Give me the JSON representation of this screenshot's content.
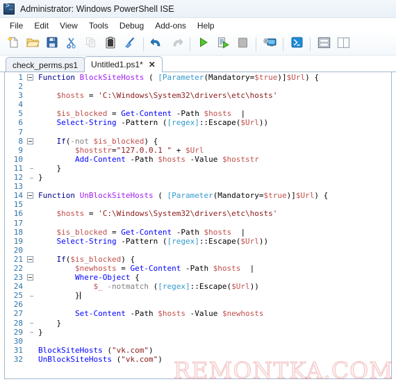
{
  "window": {
    "title": "Administrator: Windows PowerShell ISE",
    "icon": "powershell-ise-icon"
  },
  "menubar": {
    "items": [
      {
        "label": "File"
      },
      {
        "label": "Edit"
      },
      {
        "label": "View"
      },
      {
        "label": "Tools"
      },
      {
        "label": "Debug"
      },
      {
        "label": "Add-ons"
      },
      {
        "label": "Help"
      }
    ]
  },
  "toolbar": {
    "buttons": [
      {
        "name": "new-script-icon",
        "glyph": "new"
      },
      {
        "name": "open-script-icon",
        "glyph": "open"
      },
      {
        "name": "save-icon",
        "glyph": "save"
      },
      {
        "name": "cut-icon",
        "glyph": "cut"
      },
      {
        "name": "copy-icon",
        "glyph": "copy"
      },
      {
        "name": "paste-icon",
        "glyph": "paste"
      },
      {
        "name": "clear-console-icon",
        "glyph": "clear"
      },
      {
        "name": "separator-1",
        "glyph": "sep"
      },
      {
        "name": "undo-icon",
        "glyph": "undo"
      },
      {
        "name": "redo-icon",
        "glyph": "redo"
      },
      {
        "name": "separator-2",
        "glyph": "sep"
      },
      {
        "name": "run-script-icon",
        "glyph": "run"
      },
      {
        "name": "run-selection-icon",
        "glyph": "run-selection"
      },
      {
        "name": "stop-operation-icon",
        "glyph": "stop"
      },
      {
        "name": "separator-3",
        "glyph": "sep"
      },
      {
        "name": "new-remote-tab-icon",
        "glyph": "remote"
      },
      {
        "name": "separator-4",
        "glyph": "sep"
      },
      {
        "name": "start-powershell-icon",
        "glyph": "ps"
      },
      {
        "name": "separator-5",
        "glyph": "sep"
      },
      {
        "name": "show-script-pane-top-icon",
        "glyph": "pane-top"
      },
      {
        "name": "show-script-pane-right-icon",
        "glyph": "pane-right"
      }
    ]
  },
  "tabs": [
    {
      "label": "check_perms.ps1",
      "active": false,
      "closable": false
    },
    {
      "label": "Untitled1.ps1*",
      "active": true,
      "closable": true,
      "close_label": "✕"
    }
  ],
  "editor": {
    "lines": [
      {
        "n": 1,
        "fold": "start",
        "tokens": [
          {
            "t": "Function ",
            "c": "kw"
          },
          {
            "t": "BlockSiteHosts",
            "c": "fn"
          },
          {
            "t": " ( ",
            "c": "plain"
          },
          {
            "t": "[Parameter",
            "c": "attr"
          },
          {
            "t": "(Mandatory=",
            "c": "plain"
          },
          {
            "t": "$true",
            "c": "var"
          },
          {
            "t": ")]",
            "c": "plain"
          },
          {
            "t": "$Url",
            "c": "var"
          },
          {
            "t": ") {",
            "c": "plain"
          }
        ]
      },
      {
        "n": 2,
        "fold": "bar",
        "tokens": []
      },
      {
        "n": 3,
        "fold": "bar",
        "tokens": [
          {
            "t": "    ",
            "c": "plain"
          },
          {
            "t": "$hosts",
            "c": "var"
          },
          {
            "t": " = ",
            "c": "plain"
          },
          {
            "t": "'C:\\Windows\\System32\\drivers\\etc\\hosts'",
            "c": "str"
          }
        ]
      },
      {
        "n": 4,
        "fold": "bar",
        "tokens": []
      },
      {
        "n": 5,
        "fold": "bar",
        "tokens": [
          {
            "t": "    ",
            "c": "plain"
          },
          {
            "t": "$is_blocked",
            "c": "var"
          },
          {
            "t": " = ",
            "c": "plain"
          },
          {
            "t": "Get-Content",
            "c": "cmd"
          },
          {
            "t": " -Path ",
            "c": "plain"
          },
          {
            "t": "$hosts",
            "c": "var"
          },
          {
            "t": "  |",
            "c": "plain"
          }
        ]
      },
      {
        "n": 6,
        "fold": "bar",
        "tokens": [
          {
            "t": "    ",
            "c": "plain"
          },
          {
            "t": "Select-String",
            "c": "cmd"
          },
          {
            "t": " -Pattern ",
            "c": "plain"
          },
          {
            "t": "(",
            "c": "plain"
          },
          {
            "t": "[regex]",
            "c": "type"
          },
          {
            "t": "::Escape(",
            "c": "plain"
          },
          {
            "t": "$Url",
            "c": "var"
          },
          {
            "t": "))",
            "c": "plain"
          }
        ]
      },
      {
        "n": 7,
        "fold": "bar",
        "tokens": []
      },
      {
        "n": 8,
        "fold": "start",
        "tokens": [
          {
            "t": "    ",
            "c": "plain"
          },
          {
            "t": "If",
            "c": "kw"
          },
          {
            "t": "(",
            "c": "plain"
          },
          {
            "t": "-not",
            "c": "param"
          },
          {
            "t": " ",
            "c": "plain"
          },
          {
            "t": "$is_blocked",
            "c": "var"
          },
          {
            "t": ") {",
            "c": "plain"
          }
        ]
      },
      {
        "n": 9,
        "fold": "bar2",
        "tokens": [
          {
            "t": "        ",
            "c": "plain"
          },
          {
            "t": "$hoststr",
            "c": "var"
          },
          {
            "t": "=",
            "c": "plain"
          },
          {
            "t": "\"127.0.0.1 \"",
            "c": "str"
          },
          {
            "t": " + ",
            "c": "plain"
          },
          {
            "t": "$Url",
            "c": "var"
          }
        ]
      },
      {
        "n": 10,
        "fold": "bar2",
        "tokens": [
          {
            "t": "        ",
            "c": "plain"
          },
          {
            "t": "Add-Content",
            "c": "cmd"
          },
          {
            "t": " -Path ",
            "c": "plain"
          },
          {
            "t": "$hosts",
            "c": "var"
          },
          {
            "t": " -Value ",
            "c": "plain"
          },
          {
            "t": "$hoststr",
            "c": "var"
          }
        ]
      },
      {
        "n": 11,
        "fold": "end2",
        "tokens": [
          {
            "t": "    }",
            "c": "plain"
          }
        ]
      },
      {
        "n": 12,
        "fold": "end",
        "tokens": [
          {
            "t": "}",
            "c": "plain"
          }
        ]
      },
      {
        "n": 13,
        "fold": "none",
        "tokens": []
      },
      {
        "n": 14,
        "fold": "start",
        "tokens": [
          {
            "t": "Function ",
            "c": "kw"
          },
          {
            "t": "UnBlockSiteHosts",
            "c": "fn"
          },
          {
            "t": " ( ",
            "c": "plain"
          },
          {
            "t": "[Parameter",
            "c": "attr"
          },
          {
            "t": "(Mandatory=",
            "c": "plain"
          },
          {
            "t": "$true",
            "c": "var"
          },
          {
            "t": ")]",
            "c": "plain"
          },
          {
            "t": "$Url",
            "c": "var"
          },
          {
            "t": ") {",
            "c": "plain"
          }
        ]
      },
      {
        "n": 15,
        "fold": "bar",
        "tokens": []
      },
      {
        "n": 16,
        "fold": "bar",
        "tokens": [
          {
            "t": "    ",
            "c": "plain"
          },
          {
            "t": "$hosts",
            "c": "var"
          },
          {
            "t": " = ",
            "c": "plain"
          },
          {
            "t": "'C:\\Windows\\System32\\drivers\\etc\\hosts'",
            "c": "str"
          }
        ]
      },
      {
        "n": 17,
        "fold": "bar",
        "tokens": []
      },
      {
        "n": 18,
        "fold": "bar",
        "tokens": [
          {
            "t": "    ",
            "c": "plain"
          },
          {
            "t": "$is_blocked",
            "c": "var"
          },
          {
            "t": " = ",
            "c": "plain"
          },
          {
            "t": "Get-Content",
            "c": "cmd"
          },
          {
            "t": " -Path ",
            "c": "plain"
          },
          {
            "t": "$hosts",
            "c": "var"
          },
          {
            "t": "  |",
            "c": "plain"
          }
        ]
      },
      {
        "n": 19,
        "fold": "bar",
        "tokens": [
          {
            "t": "    ",
            "c": "plain"
          },
          {
            "t": "Select-String",
            "c": "cmd"
          },
          {
            "t": " -Pattern ",
            "c": "plain"
          },
          {
            "t": "(",
            "c": "plain"
          },
          {
            "t": "[regex]",
            "c": "type"
          },
          {
            "t": "::Escape(",
            "c": "plain"
          },
          {
            "t": "$Url",
            "c": "var"
          },
          {
            "t": "))",
            "c": "plain"
          }
        ]
      },
      {
        "n": 20,
        "fold": "bar",
        "tokens": []
      },
      {
        "n": 21,
        "fold": "start",
        "tokens": [
          {
            "t": "    ",
            "c": "plain"
          },
          {
            "t": "If",
            "c": "kw"
          },
          {
            "t": "(",
            "c": "plain"
          },
          {
            "t": "$is_blocked",
            "c": "var"
          },
          {
            "t": ") {",
            "c": "plain"
          }
        ]
      },
      {
        "n": 22,
        "fold": "bar2",
        "tokens": [
          {
            "t": "        ",
            "c": "plain"
          },
          {
            "t": "$newhosts",
            "c": "var"
          },
          {
            "t": " = ",
            "c": "plain"
          },
          {
            "t": "Get-Content",
            "c": "cmd"
          },
          {
            "t": " -Path ",
            "c": "plain"
          },
          {
            "t": "$hosts",
            "c": "var"
          },
          {
            "t": "  |",
            "c": "plain"
          }
        ]
      },
      {
        "n": 23,
        "fold": "start2",
        "tokens": [
          {
            "t": "        ",
            "c": "plain"
          },
          {
            "t": "Where-Object",
            "c": "cmd"
          },
          {
            "t": " {",
            "c": "plain"
          }
        ]
      },
      {
        "n": 24,
        "fold": "bar2",
        "tokens": [
          {
            "t": "            ",
            "c": "plain"
          },
          {
            "t": "$_",
            "c": "var"
          },
          {
            "t": " ",
            "c": "plain"
          },
          {
            "t": "-notmatch",
            "c": "param"
          },
          {
            "t": " (",
            "c": "plain"
          },
          {
            "t": "[regex]",
            "c": "type"
          },
          {
            "t": "::Escape(",
            "c": "plain"
          },
          {
            "t": "$Url",
            "c": "var"
          },
          {
            "t": "))",
            "c": "plain"
          }
        ]
      },
      {
        "n": 25,
        "fold": "end2",
        "tokens": [
          {
            "t": "        }",
            "c": "plain"
          }
        ],
        "caret": true
      },
      {
        "n": 26,
        "fold": "bar2",
        "tokens": []
      },
      {
        "n": 27,
        "fold": "bar2",
        "tokens": [
          {
            "t": "        ",
            "c": "plain"
          },
          {
            "t": "Set-Content",
            "c": "cmd"
          },
          {
            "t": " -Path ",
            "c": "plain"
          },
          {
            "t": "$hosts",
            "c": "var"
          },
          {
            "t": " -Value ",
            "c": "plain"
          },
          {
            "t": "$newhosts",
            "c": "var"
          }
        ]
      },
      {
        "n": 28,
        "fold": "end2",
        "tokens": [
          {
            "t": "    }",
            "c": "plain"
          }
        ]
      },
      {
        "n": 29,
        "fold": "end",
        "tokens": [
          {
            "t": "}",
            "c": "plain"
          }
        ]
      },
      {
        "n": 30,
        "fold": "none",
        "tokens": []
      },
      {
        "n": 31,
        "fold": "none",
        "tokens": [
          {
            "t": "BlockSiteHosts",
            "c": "cmd"
          },
          {
            "t": " (",
            "c": "plain"
          },
          {
            "t": "\"vk.com\"",
            "c": "str"
          },
          {
            "t": ")",
            "c": "plain"
          }
        ]
      },
      {
        "n": 32,
        "fold": "none",
        "tokens": [
          {
            "t": "UnBlockSiteHosts",
            "c": "cmd"
          },
          {
            "t": " (",
            "c": "plain"
          },
          {
            "t": "\"vk.com\"",
            "c": "str"
          },
          {
            "t": ")",
            "c": "plain"
          }
        ]
      }
    ]
  },
  "watermark": {
    "text": "REMONTKA.COM",
    "color": "#e8b4b4"
  }
}
